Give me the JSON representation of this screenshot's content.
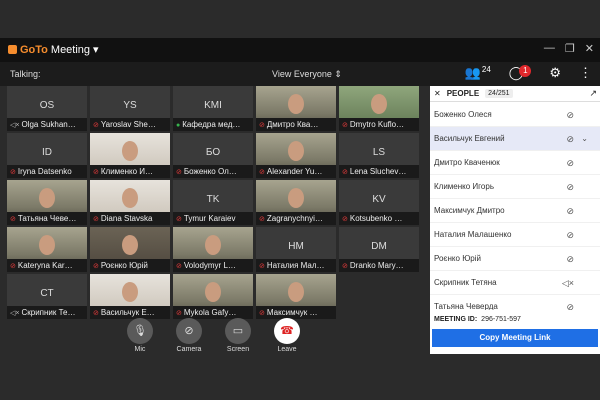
{
  "app": {
    "title": "GoToMeeting",
    "title_prefix": "GoTo",
    "title_suffix": "Meeting"
  },
  "window_controls": [
    "—",
    "❐",
    "✕"
  ],
  "toolbar": {
    "talking_label": "Talking:",
    "view_label": "View Everyone",
    "people_count": "24",
    "chat_badge": "1"
  },
  "tiles": [
    {
      "initials": "OS",
      "name": "Olga Sukhan…",
      "mic": "speaker-muted"
    },
    {
      "initials": "YS",
      "name": "Yaroslav She…",
      "mic": "muted"
    },
    {
      "initials": "KMI",
      "name": "Кафедра мед…",
      "mic": "active"
    },
    {
      "initials": "",
      "name": "Дмитро Ква…",
      "mic": "muted"
    },
    {
      "initials": "",
      "name": "Dmytro Kuflo…",
      "mic": "muted"
    },
    {
      "initials": "ID",
      "name": "Iryna Datsenko",
      "mic": "muted"
    },
    {
      "initials": "",
      "name": "Клименко И…",
      "mic": "muted"
    },
    {
      "initials": "БО",
      "name": "Боженко Ол…",
      "mic": "muted"
    },
    {
      "initials": "",
      "name": "Alexander Yu…",
      "mic": "muted"
    },
    {
      "initials": "LS",
      "name": "Lena Sluchev…",
      "mic": "muted"
    },
    {
      "initials": "",
      "name": "Татьяна Чеве…",
      "mic": "muted"
    },
    {
      "initials": "",
      "name": "Diana Stavska",
      "mic": "muted"
    },
    {
      "initials": "TK",
      "name": "Tymur Karaiev",
      "mic": "muted"
    },
    {
      "initials": "",
      "name": "Zagranychnyi…",
      "mic": "muted"
    },
    {
      "initials": "KV",
      "name": "Kotsubenko …",
      "mic": "muted"
    },
    {
      "initials": "",
      "name": "Kateryna Kar…",
      "mic": "muted"
    },
    {
      "initials": "",
      "name": "Роєнко Юрій",
      "mic": "muted"
    },
    {
      "initials": "",
      "name": "Volodymyr L…",
      "mic": "muted"
    },
    {
      "initials": "НМ",
      "name": "Наталия Мал…",
      "mic": "muted"
    },
    {
      "initials": "DM",
      "name": "Dranko Mary…",
      "mic": "muted"
    },
    {
      "initials": "CT",
      "name": "Скрипник Те…",
      "mic": "speaker-muted"
    },
    {
      "initials": "",
      "name": "Васильчук Е…",
      "mic": "muted"
    },
    {
      "initials": "",
      "name": "Mykola Gafy…",
      "mic": "muted"
    },
    {
      "initials": "",
      "name": "Максимчук …",
      "mic": "muted"
    }
  ],
  "controls": {
    "mic": "Mic",
    "camera": "Camera",
    "screen": "Screen",
    "leave": "Leave"
  },
  "people_panel": {
    "title": "PEOPLE",
    "count": "24/251",
    "items": [
      {
        "name": "Боженко Олеся",
        "mic": "muted",
        "selected": false
      },
      {
        "name": "Васильчук Евгений",
        "mic": "muted",
        "selected": true
      },
      {
        "name": "Дмитро Кваченюк",
        "mic": "muted",
        "selected": false
      },
      {
        "name": "Клименко Игорь",
        "mic": "muted",
        "selected": false
      },
      {
        "name": "Максимчук Дмитро",
        "mic": "muted",
        "selected": false
      },
      {
        "name": "Наталия Малашенко",
        "mic": "muted",
        "selected": false
      },
      {
        "name": "Роєнко Юрій",
        "mic": "muted",
        "selected": false
      },
      {
        "name": "Скрипник Тетяна",
        "mic": "speaker-muted",
        "selected": false
      },
      {
        "name": "Татьяна Чеверда",
        "mic": "muted",
        "selected": false
      }
    ],
    "meeting_id_label": "MEETING ID:",
    "meeting_id": "296-751-597",
    "copy_button": "Copy Meeting Link"
  }
}
